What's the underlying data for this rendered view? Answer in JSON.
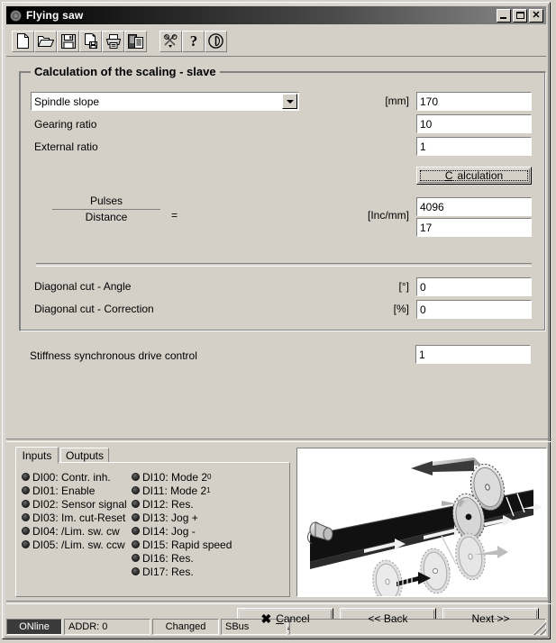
{
  "window": {
    "title": "Flying saw",
    "icon": "app-gear-icon",
    "controls": {
      "minimize": "minimize",
      "maximize": "maximize",
      "close": "close"
    }
  },
  "toolbar": {
    "buttons": [
      {
        "name": "new-document-icon",
        "tip": "New"
      },
      {
        "name": "open-folder-icon",
        "tip": "Open"
      },
      {
        "name": "save-floppy-icon",
        "tip": "Save"
      },
      {
        "name": "save-as-icon",
        "tip": "Save as"
      },
      {
        "name": "print-icon",
        "tip": "Print"
      },
      {
        "name": "document-copy-icon",
        "tip": "Copy document"
      },
      {
        "name": "tools-icon",
        "tip": "Tools"
      },
      {
        "name": "help-question-icon",
        "tip": "Help"
      },
      {
        "name": "info-power-icon",
        "tip": "Info"
      }
    ]
  },
  "group": {
    "title": "Calculation of the scaling - slave",
    "rows": [
      {
        "label": "Spindle slope",
        "unit": "[mm]",
        "value": "170",
        "type": "combo"
      },
      {
        "label": "Gearing ratio",
        "unit": "",
        "value": "10",
        "type": "text"
      },
      {
        "label": "External ratio",
        "unit": "",
        "value": "1",
        "type": "text"
      }
    ],
    "calculation_button": {
      "label": "Calculation",
      "accesskey": "C"
    },
    "fraction": {
      "numerator": "Pulses",
      "denominator": "Distance",
      "equals": "=",
      "unit": "[Inc/mm]",
      "numerator_value": "4096",
      "denominator_value": "17"
    },
    "diagonal": [
      {
        "label": "Diagonal cut - Angle",
        "unit": "[°]",
        "value": "0"
      },
      {
        "label": "Diagonal cut - Correction",
        "unit": "[%]",
        "value": "0"
      }
    ]
  },
  "stiffness": {
    "label": "Stiffness synchronous drive control",
    "value": "1"
  },
  "tabs": {
    "items": [
      {
        "label": "Inputs",
        "active": true
      },
      {
        "label": "Outputs",
        "active": false
      }
    ],
    "inputs_left": [
      "DI00: Contr. inh.",
      "DI01: Enable",
      "DI02: Sensor signal",
      "DI03: Im. cut-Reset",
      "DI04: /Lim. sw. cw",
      "DI05: /Lim. sw. ccw"
    ],
    "inputs_right": [
      {
        "text": "DI10: Mode 2",
        "sup": "0"
      },
      {
        "text": "DI11: Mode 2",
        "sup": "1"
      },
      {
        "text": "DI12: Res.",
        "sup": ""
      },
      {
        "text": "DI13: Jog +",
        "sup": ""
      },
      {
        "text": "DI14: Jog -",
        "sup": ""
      },
      {
        "text": "DI15: Rapid speed",
        "sup": ""
      },
      {
        "text": "DI16: Res.",
        "sup": ""
      },
      {
        "text": "DI17: Res.",
        "sup": ""
      }
    ]
  },
  "picture": {
    "name": "flying-saw-diagram",
    "alt": "Conveyor belt with flying saw blades"
  },
  "footer": {
    "cancel": {
      "label": "Cancel",
      "accesskey": "C",
      "icon": "x-mark-icon"
    },
    "back": {
      "label": "<< Back"
    },
    "next": {
      "label": "Next >>"
    }
  },
  "statusbar": {
    "online": "ONline",
    "address": "ADDR: 0",
    "changed": "Changed",
    "bus": "SBus",
    "message": ""
  },
  "colors": {
    "face": "#d4d0c8",
    "field": "#ffffff",
    "shadow": "#808080",
    "title_dark": "#000000"
  }
}
